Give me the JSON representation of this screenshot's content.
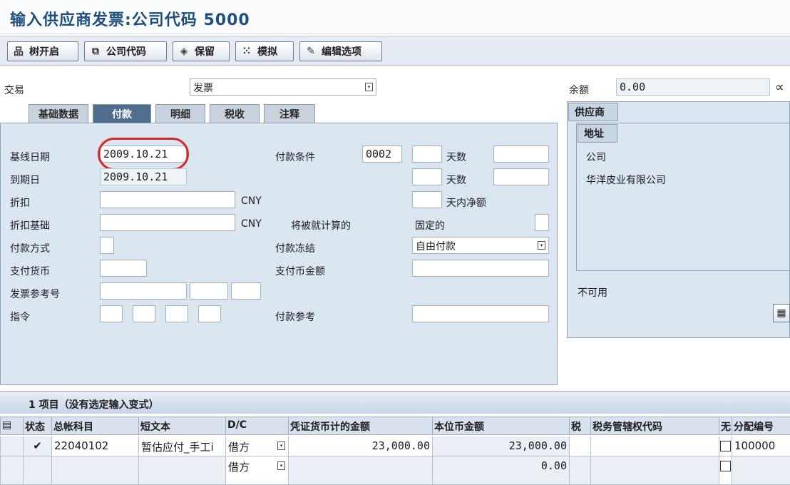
{
  "window": {
    "title": "输入供应商发票:公司代码 5000"
  },
  "toolbar": {
    "tree_on": "树开启",
    "company_code": "公司代码",
    "hold": "保留",
    "simulate": "模拟",
    "edit_options": "编辑选项"
  },
  "header": {
    "transaction_label": "交易",
    "transaction_value": "发票",
    "balance_label": "余额",
    "balance_value": "0.00"
  },
  "tabs": [
    {
      "label": "基础数据",
      "active": false
    },
    {
      "label": "付款",
      "active": true
    },
    {
      "label": "明细",
      "active": false
    },
    {
      "label": "税收",
      "active": false
    },
    {
      "label": "注释",
      "active": false
    }
  ],
  "payment": {
    "baseline_date_label": "基线日期",
    "baseline_date": "2009.10.21",
    "due_date_label": "到期日",
    "due_date": "2009.10.21",
    "discount_label": "折扣",
    "discount_currency": "CNY",
    "discount_base_label": "折扣基础",
    "discount_base_currency": "CNY",
    "payment_method_label": "付款方式",
    "payment_currency_label": "支付货币",
    "invoice_ref_label": "发票参考号",
    "instruction_label": "指令",
    "terms_label": "付款条件",
    "terms_value": "0002",
    "days_label_1": "天数",
    "days_label_2": "天数",
    "net_days_label": "天内净额",
    "to_be_calculated_label": "将被就计算的",
    "fixed_label": "固定的",
    "payment_block_label": "付款冻结",
    "payment_block_value": "自由付款",
    "payment_currency_amount_label": "支付币金额",
    "payment_ref_label": "付款参考"
  },
  "vendor": {
    "section_label": "供应商",
    "address_tab": "地址",
    "company_label": "公司",
    "company_name": "华洋皮业有限公司",
    "not_available": "不可用"
  },
  "items": {
    "header": "1 项目（没有选定输入变式）",
    "columns": [
      "状态",
      "总帐科目",
      "短文本",
      "D/C",
      "凭证货币计的金额",
      "本位币金额",
      "税",
      "税务管辖权代码",
      "无",
      "分配编号"
    ],
    "rows": [
      {
        "status": "✔",
        "gl_account": "22040102",
        "short_text": "暂估应付_手工i",
        "dc": "借方",
        "doc_amount": "23,000.00",
        "local_amount": "23,000.00",
        "assignment": "100000"
      },
      {
        "status": "",
        "gl_account": "",
        "short_text": "",
        "dc": "借方",
        "doc_amount": "",
        "local_amount": "0.00",
        "assignment": ""
      }
    ]
  }
}
